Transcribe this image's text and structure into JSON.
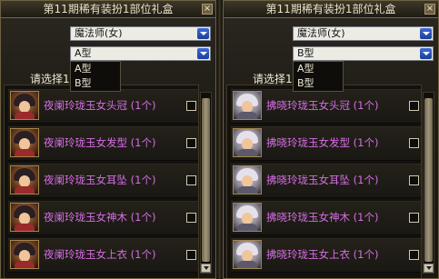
{
  "left_panel": {
    "title": "第11期稀有装扮1部位礼盒",
    "class_select": "魔法师(女)",
    "type_select": "A型",
    "type_options": [
      "A型",
      "B型"
    ],
    "prompt": "请选择1",
    "items": [
      {
        "name": "夜阑玲珑玉女头冠 (1个)"
      },
      {
        "name": "夜阑玲珑玉女发型 (1个)"
      },
      {
        "name": "夜阑玲珑玉女耳坠 (1个)"
      },
      {
        "name": "夜阑玲珑玉女神木 (1个)"
      },
      {
        "name": "夜阑玲珑玉女上衣 (1个)"
      }
    ]
  },
  "right_panel": {
    "title": "第11期稀有装扮1部位礼盒",
    "class_select": "魔法师(女)",
    "type_select": "B型",
    "type_options": [
      "A型",
      "B型"
    ],
    "prompt": "请选择1",
    "items": [
      {
        "name": "拂晓玲珑玉女头冠 (1个)"
      },
      {
        "name": "拂晓玲珑玉女发型 (1个)"
      },
      {
        "name": "拂晓玲珑玉女耳坠 (1个)"
      },
      {
        "name": "拂晓玲珑玉女神木 (1个)"
      },
      {
        "name": "拂晓玲珑玉女上衣 (1个)"
      }
    ]
  },
  "colors": {
    "item_name": "#d56ee4",
    "select_arrow": "#2a55c0",
    "panel_border": "#6e6242"
  }
}
